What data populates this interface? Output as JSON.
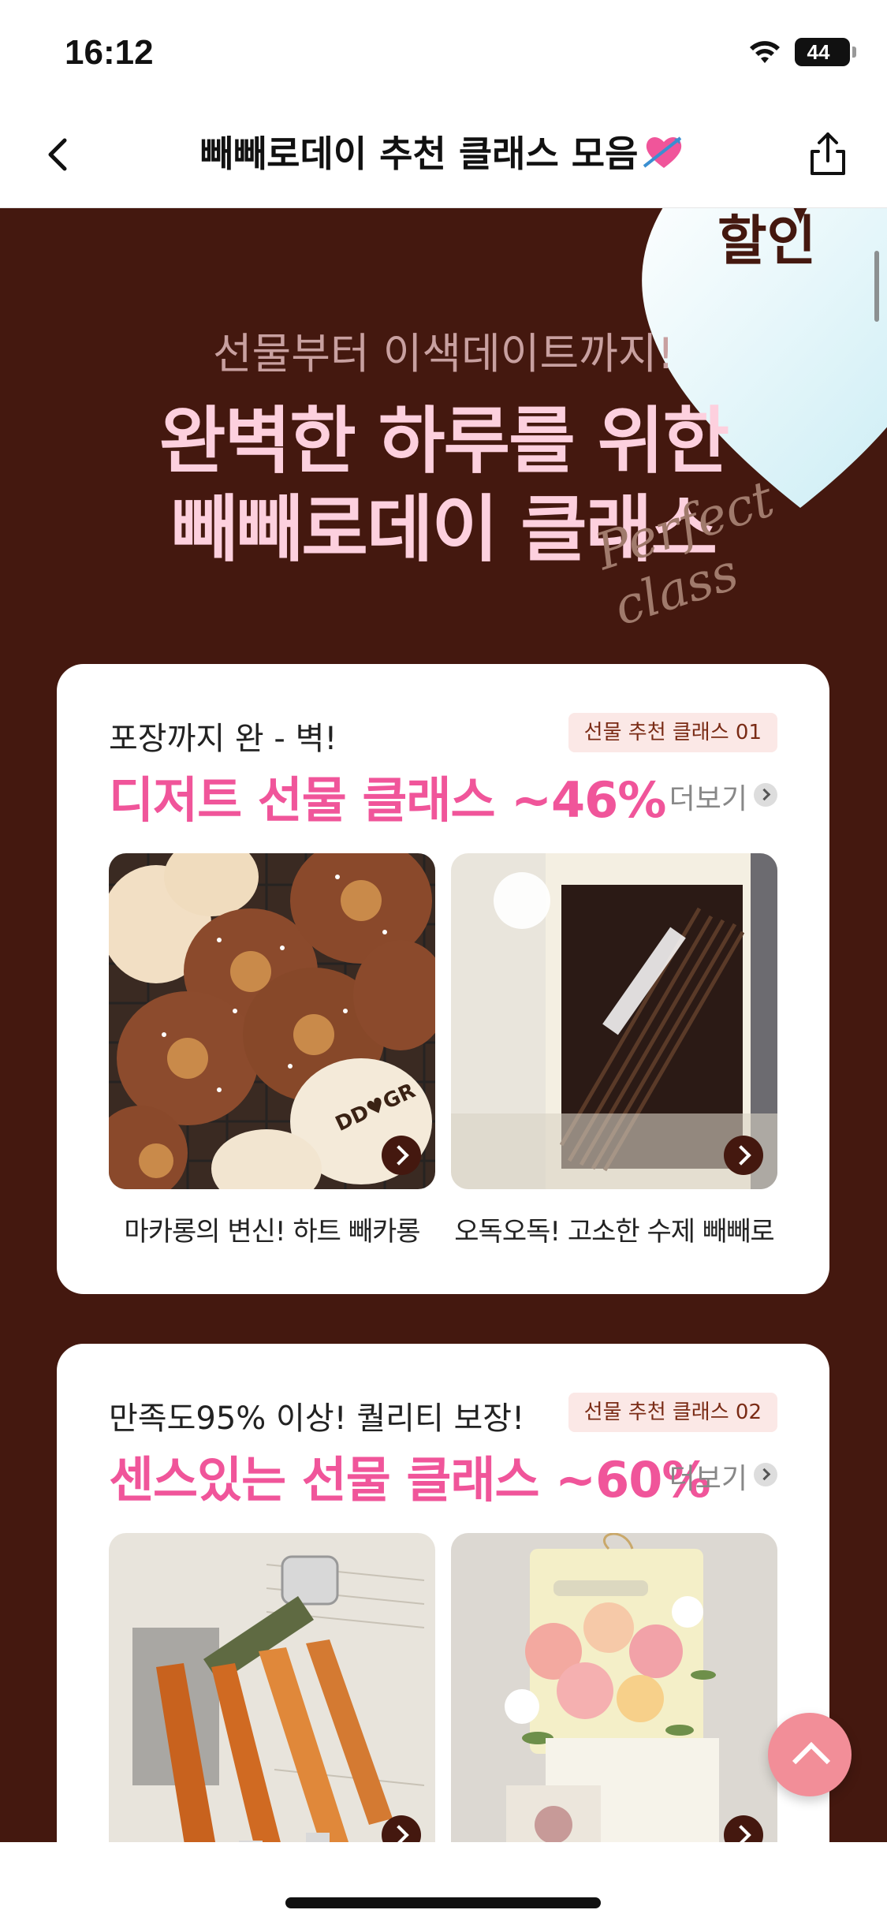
{
  "status_bar": {
    "time": "16:12",
    "battery": "44"
  },
  "nav": {
    "title": "빼빼로데이 추천 클래스 모음"
  },
  "hero": {
    "corner_text": "할인",
    "subtitle": "선물부터 이색데이트까지!",
    "title_line1": "완벽한 하루를 위한",
    "title_line2": "빼빼로데이 클래스",
    "decor_text": "Perfect class"
  },
  "sections": [
    {
      "tagline": "포장까지 완 - 벽!",
      "tag": "선물 추천 클래스 01",
      "headline": "디저트 선물 클래스 ~46%",
      "more": "더보기",
      "products": [
        {
          "name": "마카롱의 변신! 하트 빼카롱",
          "image_text": "DD♥GR"
        },
        {
          "name": "오독오독! 고소한 수제 빼빼로"
        }
      ]
    },
    {
      "tagline": "만족도95% 이상! 퀄리티 보장!",
      "tag": "선물 추천 클래스 02",
      "headline": "센스있는 선물 클래스 ~60%",
      "more": "더보기",
      "products": [
        {
          "name": ""
        },
        {
          "name": ""
        }
      ]
    }
  ],
  "colors": {
    "brown": "#44180f",
    "pink": "#f0559a",
    "light_pink": "#fdd0de",
    "tag_bg": "#fbe8e6",
    "fab": "#f28e98"
  }
}
